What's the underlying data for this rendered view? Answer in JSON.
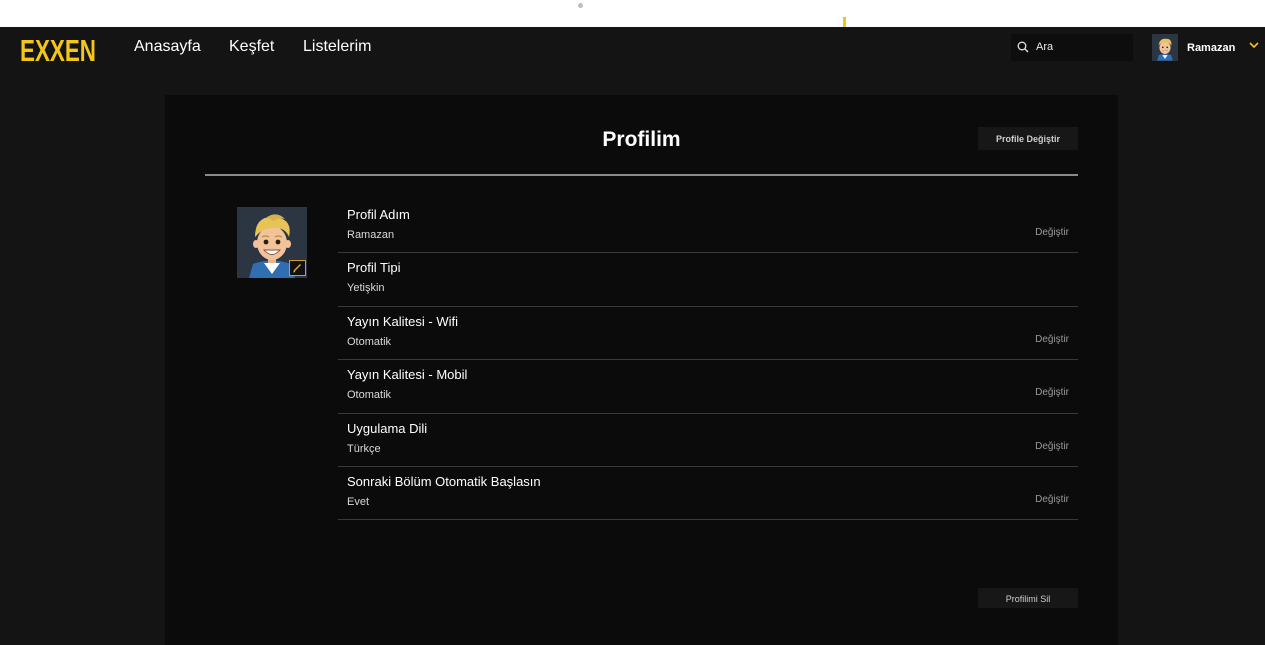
{
  "nav": {
    "logo_text": "EXXEN",
    "links": [
      "Anasayfa",
      "Keşfet",
      "Listelerim"
    ],
    "search_value": "Ara",
    "user_name": "Ramazan",
    "accent_color": "#f5c518"
  },
  "profile": {
    "title": "Profilim",
    "change_profile_label": "Profile Değiştir",
    "delete_profile_label": "Profilimi Sil",
    "rows": [
      {
        "label": "Profil Adım",
        "value": "Ramazan",
        "action": "Değiştir"
      },
      {
        "label": "Profil Tipi",
        "value": "Yetişkin",
        "action": ""
      },
      {
        "label": "Yayın Kalitesi - Wifi",
        "value": "Otomatik",
        "action": "Değiştir"
      },
      {
        "label": "Yayın Kalitesi - Mobil",
        "value": "Otomatik",
        "action": "Değiştir"
      },
      {
        "label": "Uygulama Dili",
        "value": "Türkçe",
        "action": "Değiştir"
      },
      {
        "label": "Sonraki Bölüm Otomatik Başlasın",
        "value": "Evet",
        "action": "Değiştir"
      }
    ]
  },
  "icons": {
    "search": "search-icon",
    "edit": "pencil-icon",
    "dropdown": "chevron-down-icon"
  }
}
